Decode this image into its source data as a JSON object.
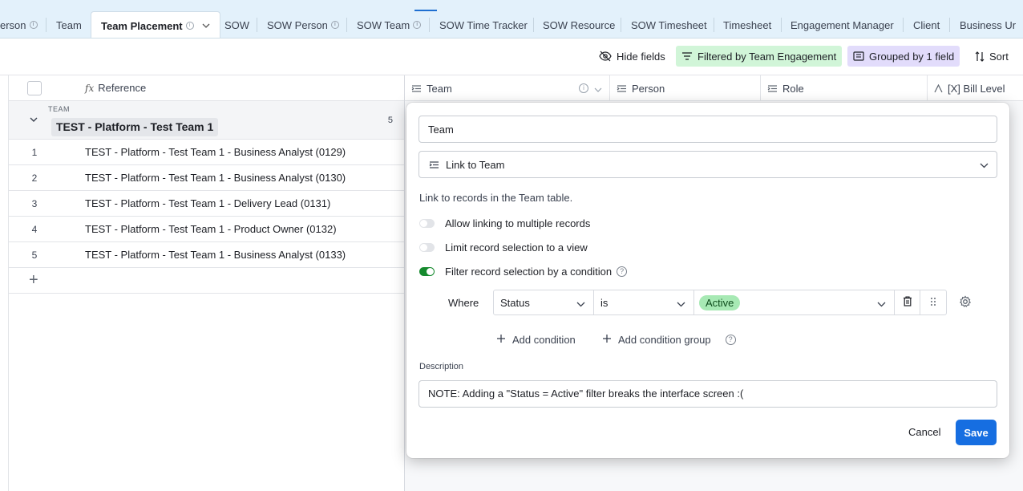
{
  "tabs": [
    {
      "label": "erson",
      "info": true
    },
    {
      "label": "Team",
      "info": false
    },
    {
      "label": "Team Placement",
      "info": true,
      "active": true
    },
    {
      "label": "SOW",
      "info": false
    },
    {
      "label": "SOW Person",
      "info": true
    },
    {
      "label": "SOW Team",
      "info": true
    },
    {
      "label": "SOW Time Tracker",
      "info": false
    },
    {
      "label": "SOW Resource",
      "info": false
    },
    {
      "label": "SOW Timesheet",
      "info": false
    },
    {
      "label": "Timesheet",
      "info": false
    },
    {
      "label": "Engagement Manager",
      "info": false
    },
    {
      "label": "Client",
      "info": false
    },
    {
      "label": "Business Ur",
      "info": false
    }
  ],
  "toolbar": {
    "hide_fields": "Hide fields",
    "filtered": "Filtered by Team Engagement",
    "grouped": "Grouped by 1 field",
    "sort": "Sort"
  },
  "grid": {
    "columns": {
      "reference": "Reference",
      "team": "Team",
      "person": "Person",
      "role": "Role",
      "bill_level": "[X] Bill Level"
    },
    "group": {
      "tag": "TEAM",
      "name": "TEST - Platform - Test Team 1",
      "count": "5"
    },
    "rows": [
      {
        "num": "1",
        "ref": "TEST - Platform - Test Team 1 - Business Analyst (0129)"
      },
      {
        "num": "2",
        "ref": "TEST - Platform - Test Team 1 - Business Analyst (0130)"
      },
      {
        "num": "3",
        "ref": "TEST - Platform - Test Team 1 - Delivery Lead (0131)"
      },
      {
        "num": "4",
        "ref": "TEST - Platform - Test Team 1 - Product Owner (0132)"
      },
      {
        "num": "5",
        "ref": "TEST - Platform - Test Team 1 - Business Analyst (0133)"
      }
    ],
    "add_row": "+"
  },
  "dialog": {
    "field_name": "Team",
    "field_type": "Link to Team",
    "type_description": "Link to records in the Team table.",
    "options": [
      {
        "label": "Allow linking to multiple records",
        "on": false
      },
      {
        "label": "Limit record selection to a view",
        "on": false
      },
      {
        "label": "Filter record selection by a condition",
        "on": true
      }
    ],
    "condition": {
      "where": "Where",
      "field": "Status",
      "operator": "is",
      "value": "Active"
    },
    "add_condition": "Add condition",
    "add_condition_group": "Add condition group",
    "description_label": "Description",
    "description_value": "NOTE: Adding a \"Status = Active\" filter breaks the interface screen :(",
    "cancel": "Cancel",
    "save": "Save"
  },
  "colors": {
    "tabbar_bg": "#e3f1fb",
    "filter_bg": "#d1f5d8",
    "group_bg": "#e2dcfb",
    "primary": "#166ee1",
    "toggle_on": "#168a2e",
    "pill": "#a7e9b4"
  }
}
